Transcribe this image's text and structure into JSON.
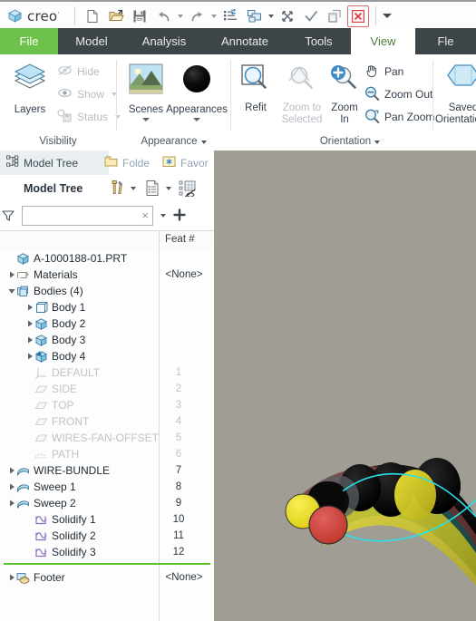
{
  "app": {
    "brand": "creo",
    "brand_sup": "·"
  },
  "quick_access": {
    "buttons": [
      {
        "name": "new-file-icon",
        "title": "New"
      },
      {
        "name": "open-file-icon",
        "title": "Open"
      },
      {
        "name": "save-icon",
        "title": "Save"
      },
      {
        "name": "undo-icon",
        "title": "Undo"
      },
      {
        "name": "undo-dropdown-icon",
        "title": "Undo options"
      },
      {
        "name": "redo-icon",
        "title": "Redo"
      },
      {
        "name": "redo-dropdown-icon",
        "title": "Redo options"
      },
      {
        "name": "regenerate-icon",
        "title": "Regenerate"
      },
      {
        "name": "window-icon",
        "title": "Window"
      },
      {
        "name": "window-dropdown-icon",
        "title": "Window options"
      },
      {
        "name": "close-window-icon",
        "title": "Close"
      },
      {
        "name": "check-icon",
        "title": "Accept"
      },
      {
        "name": "cascade-icon",
        "title": "Cascade"
      },
      {
        "name": "close-x-icon",
        "title": "Close"
      },
      {
        "name": "customize-dropdown-icon",
        "title": "Customize Quick Access Toolbar"
      }
    ]
  },
  "ribbon": {
    "tabs": [
      {
        "label": "File",
        "state": "file"
      },
      {
        "label": "Model",
        "state": "normal"
      },
      {
        "label": "Analysis",
        "state": "normal"
      },
      {
        "label": "Annotate",
        "state": "normal"
      },
      {
        "label": "Tools",
        "state": "normal"
      },
      {
        "label": "View",
        "state": "active"
      },
      {
        "label": "Fle",
        "state": "normal"
      }
    ],
    "groups": [
      {
        "name": "visibility",
        "label": "Visibility",
        "has_dialog_launcher": false,
        "big_buttons": [
          {
            "label": "Layers",
            "icon": "layers-icon",
            "disabled": false
          }
        ],
        "small_buttons": [
          {
            "label": "Hide",
            "icon": "hide-eye-icon",
            "disabled": true,
            "dropdown": false
          },
          {
            "label": "Show",
            "icon": "show-eye-icon",
            "disabled": true,
            "dropdown": true
          },
          {
            "label": "Status",
            "icon": "layer-status-icon",
            "disabled": true,
            "dropdown": true
          }
        ]
      },
      {
        "name": "appearance",
        "label": "Appearance",
        "has_dialog_launcher": true,
        "big_buttons": [
          {
            "label": "Scenes",
            "icon": "scenes-icon",
            "disabled": false,
            "dropdown": true
          },
          {
            "label": "Appearances",
            "icon": "appearances-icon",
            "disabled": false,
            "dropdown": true
          }
        ],
        "small_buttons": []
      },
      {
        "name": "orientation",
        "label": "Orientation",
        "has_dialog_launcher": true,
        "big_buttons": [
          {
            "label": "Refit",
            "icon": "refit-icon",
            "disabled": false
          },
          {
            "label": "Zoom to\nSelected",
            "icon": "zoom-to-selected-icon",
            "disabled": true
          },
          {
            "label": "Zoom\nIn",
            "icon": "zoom-in-icon",
            "disabled": false
          },
          {
            "label": "Saved\nOrientations",
            "icon": "saved-orientations-icon",
            "disabled": false
          }
        ],
        "small_buttons": [
          {
            "label": "Pan",
            "icon": "pan-hand-icon",
            "disabled": false,
            "dropdown": false
          },
          {
            "label": "Zoom Out",
            "icon": "zoom-out-icon",
            "disabled": false,
            "dropdown": false
          },
          {
            "label": "Pan Zoom",
            "icon": "pan-zoom-icon",
            "disabled": false,
            "dropdown": false
          }
        ]
      }
    ]
  },
  "panel": {
    "tabs": [
      {
        "label": "Model Tree",
        "icon": "model-tree-icon",
        "selected": true,
        "faded": false
      },
      {
        "label": "Folde",
        "icon": "folder-icon",
        "selected": false,
        "faded": true
      },
      {
        "label": "Favor",
        "icon": "favorites-icon",
        "selected": false,
        "faded": true
      }
    ],
    "toolbar": {
      "title": "Model Tree",
      "buttons": [
        {
          "name": "tools-settings-icon",
          "dropdown": true
        },
        {
          "name": "tree-columns-icon",
          "dropdown": true
        },
        {
          "name": "tree-filters-hide-icon",
          "dropdown": false
        }
      ]
    },
    "filter": {
      "icon": "filter-funnel-icon",
      "value": "",
      "placeholder": "",
      "clear_glyph": "×",
      "dropdown_name": "filter-dropdown-icon",
      "add_name": "filter-add-icon"
    },
    "columns": [
      {
        "label": "",
        "name": "column-header-name"
      },
      {
        "label": "Feat #",
        "name": "column-header-feat-num"
      }
    ]
  },
  "tree": {
    "rows": [
      {
        "label": "A-1000188-01.PRT",
        "icon": "part-icon",
        "indent": 0,
        "arrow": "none",
        "feat": "",
        "value": "",
        "dim": false
      },
      {
        "label": "Materials",
        "icon": "materials-icon",
        "indent": 0,
        "arrow": "collapsed",
        "feat": "",
        "value": "<None>",
        "dim": false
      },
      {
        "label": "Bodies (4)",
        "icon": "bodies-icon",
        "indent": 0,
        "arrow": "expanded",
        "feat": "",
        "value": "",
        "dim": false
      },
      {
        "label": "Body 1",
        "icon": "body-outline-icon",
        "indent": 1,
        "arrow": "collapsed",
        "feat": "",
        "value": "",
        "dim": false
      },
      {
        "label": "Body 2",
        "icon": "body-solid-icon",
        "indent": 1,
        "arrow": "collapsed",
        "feat": "",
        "value": "",
        "dim": false
      },
      {
        "label": "Body 3",
        "icon": "body-solid-icon",
        "indent": 1,
        "arrow": "collapsed",
        "feat": "",
        "value": "",
        "dim": false
      },
      {
        "label": "Body 4",
        "icon": "body-default-icon",
        "indent": 1,
        "arrow": "collapsed",
        "feat": "",
        "value": "",
        "dim": false
      },
      {
        "label": "DEFAULT",
        "icon": "csys-icon",
        "indent": 0,
        "arrow": "none",
        "feat": "1",
        "value": "",
        "dim": true
      },
      {
        "label": "SIDE",
        "icon": "datum-plane-icon",
        "indent": 0,
        "arrow": "none",
        "feat": "2",
        "value": "",
        "dim": true
      },
      {
        "label": "TOP",
        "icon": "datum-plane-icon",
        "indent": 0,
        "arrow": "none",
        "feat": "3",
        "value": "",
        "dim": true
      },
      {
        "label": "FRONT",
        "icon": "datum-plane-icon",
        "indent": 0,
        "arrow": "none",
        "feat": "4",
        "value": "",
        "dim": true
      },
      {
        "label": "WIRES-FAN-OFFSET",
        "icon": "datum-plane-icon",
        "indent": 0,
        "arrow": "none",
        "feat": "5",
        "value": "",
        "dim": true
      },
      {
        "label": "PATH",
        "icon": "curve-icon",
        "indent": 0,
        "arrow": "none",
        "feat": "6",
        "value": "",
        "dim": true
      },
      {
        "label": "WIRE-BUNDLE",
        "icon": "sweep-icon",
        "indent": 0,
        "arrow": "collapsed",
        "feat": "7",
        "value": "",
        "dim": false
      },
      {
        "label": "Sweep 1",
        "icon": "sweep-icon",
        "indent": 0,
        "arrow": "collapsed",
        "feat": "8",
        "value": "",
        "dim": false
      },
      {
        "label": "Sweep 2",
        "icon": "sweep-icon",
        "indent": 0,
        "arrow": "collapsed",
        "feat": "9",
        "value": "",
        "dim": false
      },
      {
        "label": "Solidify 1",
        "icon": "solidify-icon",
        "indent": 0,
        "arrow": "none",
        "feat": "10",
        "value": "",
        "dim": false
      },
      {
        "label": "Solidify 2",
        "icon": "solidify-icon",
        "indent": 0,
        "arrow": "none",
        "feat": "11",
        "value": "",
        "dim": false
      },
      {
        "label": "Solidify 3",
        "icon": "solidify-icon",
        "indent": 0,
        "arrow": "none",
        "feat": "12",
        "value": "",
        "dim": false
      },
      {
        "label": "Footer",
        "icon": "footer-icon",
        "indent": 0,
        "arrow": "collapsed",
        "feat": "",
        "value": "<None>",
        "dim": false
      }
    ],
    "insert_indicator_after_index": 18
  },
  "viewport": {
    "background": "#a09d94",
    "highlight_color": "#2ae0e8",
    "model_colors": [
      "#e8e02a",
      "#d43a3a",
      "#0d0d0d",
      "#6e3c3c",
      "#1f5e5e",
      "#b8b020"
    ]
  },
  "colors": {
    "accent_green": "#6cc24a",
    "tab_bar": "#3e4548",
    "active_tab_text": "#4e7a3a",
    "panel_tab_selected": "#e9eff0",
    "insert_bar": "#5cc22e"
  }
}
